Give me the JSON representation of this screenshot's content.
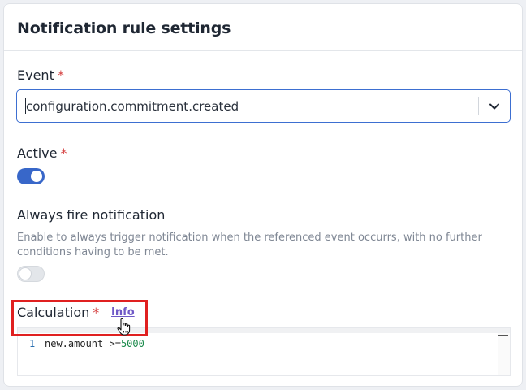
{
  "card": {
    "title": "Notification rule settings"
  },
  "event": {
    "label": "Event",
    "required_mark": "*",
    "value": "configuration.commitment.created"
  },
  "active": {
    "label": "Active",
    "required_mark": "*",
    "on": true
  },
  "always_fire": {
    "label": "Always fire notification",
    "help": "Enable to always trigger notification when the referenced event occurrs, with no further conditions having to be met.",
    "on": false
  },
  "calculation": {
    "label": "Calculation",
    "required_mark": "*",
    "info_link": "Info",
    "editor": {
      "line_number": "1",
      "code_prefix": "new.amount ",
      "code_operator": ">=",
      "code_number": "5000"
    }
  },
  "colors": {
    "accent": "#3867c9",
    "required": "#d64545",
    "link": "#6f59c7",
    "highlight": "#e02020"
  },
  "icons": {
    "dropdown": "chevron-down-icon",
    "cursor": "hand-pointer-icon"
  }
}
